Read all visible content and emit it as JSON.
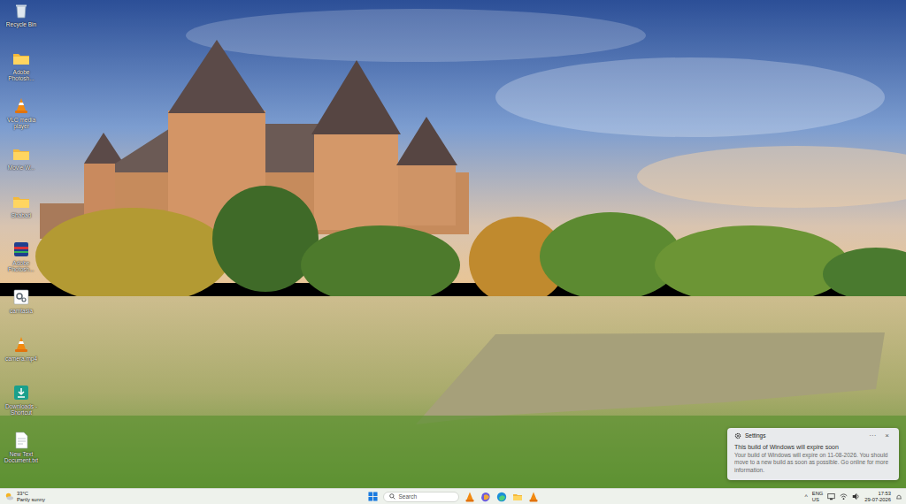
{
  "desktop": {
    "icons": [
      {
        "label": "Recycle Bin",
        "kind": "recycle"
      },
      {
        "label": "Adobe Photosh...",
        "kind": "folder"
      },
      {
        "label": "VLC media player",
        "kind": "vlc"
      },
      {
        "label": "Movie W...",
        "kind": "folder"
      },
      {
        "label": "Shabad",
        "kind": "folder"
      },
      {
        "label": "Adobe Photosh...",
        "kind": "colorapp"
      },
      {
        "label": "camtasia",
        "kind": "gear"
      },
      {
        "label": "camera.mp4",
        "kind": "vlc"
      },
      {
        "label": "Downloads - Shortcut",
        "kind": "download"
      },
      {
        "label": "New Text Document.txt",
        "kind": "text"
      }
    ]
  },
  "notification": {
    "app": "Settings",
    "more": "···",
    "close": "×",
    "title": "This build of Windows will expire soon",
    "body": "Your build of Windows will expire on 11-08-2026. You should move to a new build as soon as possible. Go online for more information."
  },
  "taskbar": {
    "weather": {
      "temperature": "33°C",
      "condition": "Partly sunny"
    },
    "search": {
      "placeholder": "Search"
    },
    "apps": [
      {
        "kind": "vlc"
      },
      {
        "kind": "copilot"
      },
      {
        "kind": "edge"
      },
      {
        "kind": "explorer"
      },
      {
        "kind": "vlc"
      }
    ],
    "tray": {
      "overflow": "^",
      "language": "ENG",
      "region": "US",
      "time": "17:53",
      "date": "29-07-2026"
    }
  }
}
